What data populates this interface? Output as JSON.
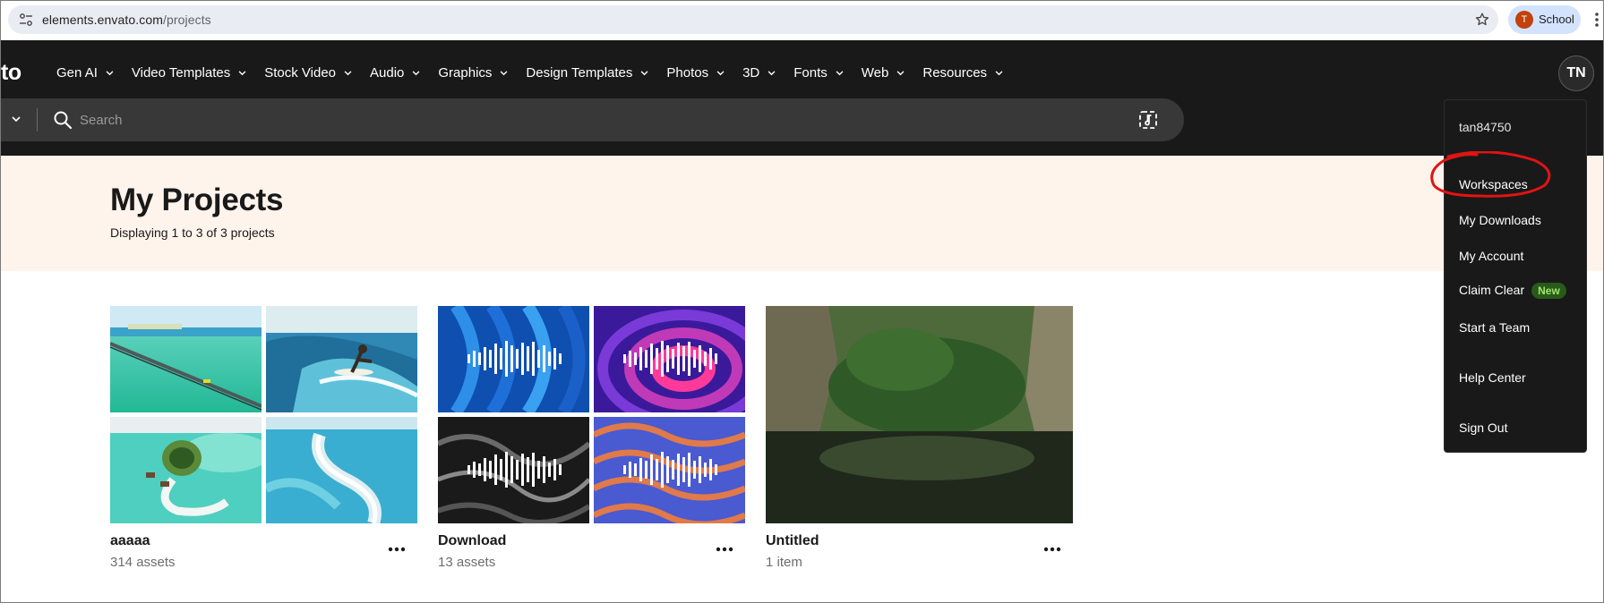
{
  "browser": {
    "url_host": "elements.envato.com",
    "url_path": "/projects",
    "profile_initial": "T",
    "profile_name": "School"
  },
  "header": {
    "logo": "to",
    "nav": [
      {
        "label": "Gen AI"
      },
      {
        "label": "Video Templates"
      },
      {
        "label": "Stock Video"
      },
      {
        "label": "Audio"
      },
      {
        "label": "Graphics"
      },
      {
        "label": "Design Templates"
      },
      {
        "label": "Photos"
      },
      {
        "label": "3D"
      },
      {
        "label": "Fonts"
      },
      {
        "label": "Web"
      },
      {
        "label": "Resources"
      }
    ],
    "avatar_initials": "TN",
    "search_placeholder": "Search"
  },
  "hero": {
    "title": "My Projects",
    "subtitle": "Displaying 1 to 3 of 3 projects"
  },
  "projects": [
    {
      "name": "aaaaa",
      "count": "314 assets"
    },
    {
      "name": "Download",
      "count": "13 assets"
    },
    {
      "name": "Untitled",
      "count": "1 item"
    }
  ],
  "account_menu": {
    "username": "tan84750",
    "items": [
      {
        "label": "Workspaces"
      },
      {
        "label": "My Downloads"
      },
      {
        "label": "My Account"
      },
      {
        "label": "Claim Clear",
        "badge": "New"
      },
      {
        "label": "Start a Team"
      },
      {
        "label": "Help Center"
      },
      {
        "label": "Sign Out"
      }
    ]
  },
  "colors": {
    "header_bg": "#191919",
    "hero_bg": "#fef4ec",
    "annotation": "#e01414",
    "badge_text": "#9ee66a"
  }
}
